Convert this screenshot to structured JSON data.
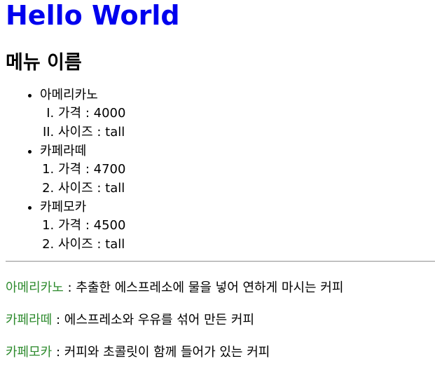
{
  "page": {
    "title": "Hello World",
    "menu_heading": "메뉴 이름"
  },
  "menu": {
    "items": [
      {
        "name": "아메리카노",
        "details": [
          "가격 : 4000",
          "사이즈 : tall"
        ]
      },
      {
        "name": "카페라떼",
        "details": [
          "가격 : 4700",
          "사이즈 : tall"
        ]
      },
      {
        "name": "카페모카",
        "details": [
          "가격 : 4500",
          "사이즈 : tall"
        ]
      }
    ]
  },
  "descriptions": [
    {
      "term": "아메리카노",
      "separator": " : ",
      "text": "추출한 에스프레소에 물을 넣어 연하게 마시는 커피"
    },
    {
      "term": "카페라떼",
      "separator": " : ",
      "text": "에스프레소와 우유를 섞어 만든 커피"
    },
    {
      "term": "카페모카",
      "separator": " : ",
      "text": "커피와 초콜릿이 함께 들어가 있는 커피"
    }
  ],
  "colors": {
    "title": "#0000ee",
    "term": "#2e8b2e",
    "text": "#000000",
    "rule": "#a0a0a0"
  }
}
